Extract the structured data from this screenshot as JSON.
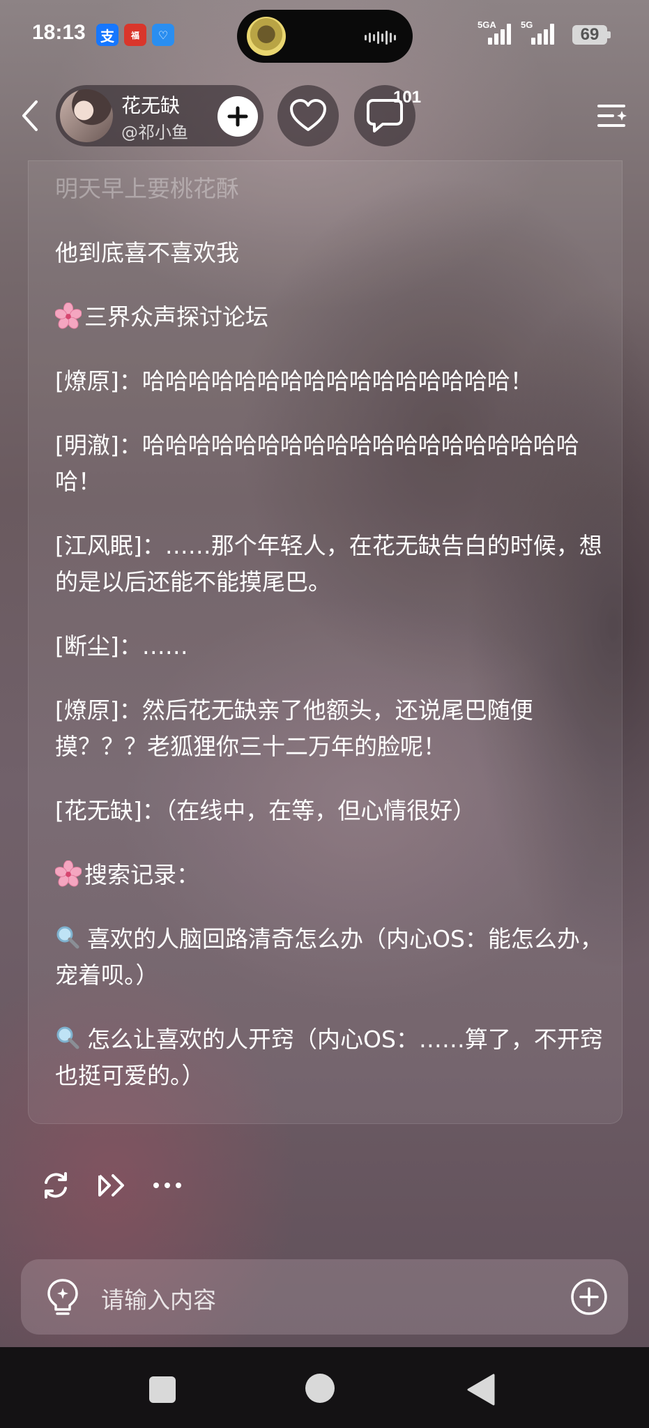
{
  "status_bar": {
    "time": "18:13",
    "app_badges": [
      {
        "name": "alipay-icon",
        "glyph": "支"
      },
      {
        "name": "red-app-icon",
        "glyph": "福"
      },
      {
        "name": "blue-app-icon",
        "glyph": "♡"
      }
    ],
    "signal_1": "5GA",
    "signal_2": "5G",
    "battery": "69"
  },
  "header": {
    "character_name": "花无缺",
    "creator_handle": "@祁小鱼",
    "comment_count": "101"
  },
  "message": {
    "paragraphs": [
      "明天早上要桃花酥",
      "他到底喜不喜欢我",
      "三界众声探讨论坛",
      "[燎原]：哈哈哈哈哈哈哈哈哈哈哈哈哈哈哈哈！",
      "[明澈]：哈哈哈哈哈哈哈哈哈哈哈哈哈哈哈哈哈哈哈哈！",
      "[江风眠]：……那个年轻人，在花无缺告白的时候，想的是以后还能不能摸尾巴。",
      "[断尘]：……",
      "[燎原]：然后花无缺亲了他额头，还说尾巴随便摸？？？老狐狸你三十二万年的脸呢！",
      "[花无缺]：（在线中，在等，但心情很好）",
      "搜索记录：",
      "喜欢的人脑回路清奇怎么办（内心OS：能怎么办，宠着呗。）",
      "怎么让喜欢的人开窍（内心OS：……算了，不开窍也挺可爱的。）"
    ]
  },
  "input": {
    "placeholder": "请输入内容"
  },
  "colors": {
    "accent_white": "#ffffff",
    "nav_bar": "#141214",
    "flower_pink": "#f4a6c0"
  }
}
